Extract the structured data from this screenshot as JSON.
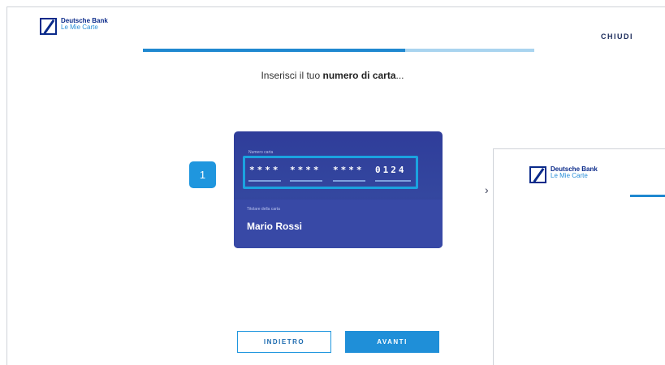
{
  "app": {
    "brand": "Deutsche Bank",
    "product": "Le Mie Carte"
  },
  "header": {
    "close_label": "CHIUDI"
  },
  "progress": {
    "value": 0.67
  },
  "heading": {
    "prefix": "Inserisci il tuo ",
    "emphasis": "numero di carta",
    "suffix": "..."
  },
  "card": {
    "number_label": "Numero carta",
    "number_groups": [
      "****",
      "****",
      "****",
      "0124"
    ],
    "holder_label": "Titolare della carta",
    "holder_name": "Mario Rossi"
  },
  "step": {
    "number": "1"
  },
  "buttons": {
    "back_label": "INDIETRO",
    "next_label": "AVANTI"
  },
  "preview": {
    "brand": "Deutsche Bank",
    "product": "Le Mie Carte",
    "chevron": "›"
  },
  "colors": {
    "brand_blue": "#0a2a8a",
    "accent_blue": "#1f8fd8",
    "card_blue": "#2f3d9a"
  }
}
